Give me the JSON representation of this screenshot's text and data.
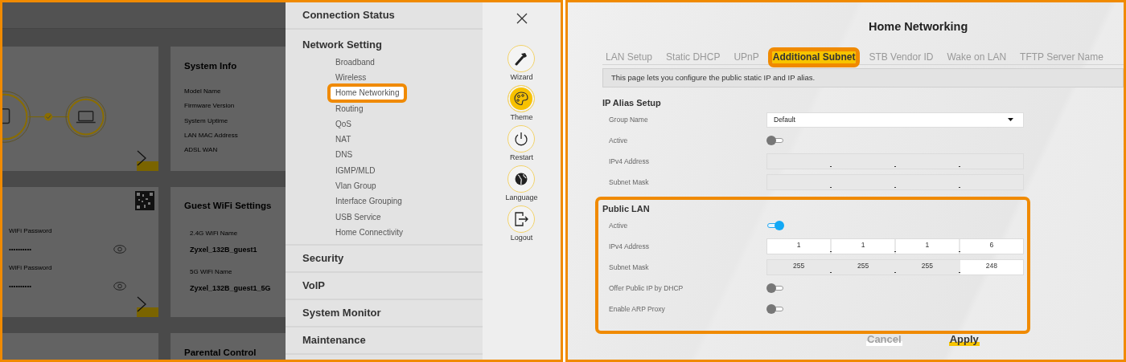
{
  "dashboard": {
    "system_info": {
      "title": "System Info",
      "labels": [
        "Model Name",
        "Firmware Version",
        "System Uptime",
        "LAN MAC Address",
        "ADSL WAN"
      ]
    },
    "wifi": {
      "fields": [
        {
          "label": "WiFi Password",
          "value": "••••••••••"
        },
        {
          "label": "WiFi Password",
          "value": "••••••••••"
        }
      ]
    },
    "guest_wifi": {
      "title": "Guest WiFi Settings",
      "fields": [
        {
          "label": "2.4G WiFi Name",
          "value": "Zyxel_132B_guest1"
        },
        {
          "label": "5G WiFi Name",
          "value": "Zyxel_132B_guest1_5G"
        }
      ]
    },
    "parental_control": {
      "title": "Parental Control"
    }
  },
  "menu": {
    "sections": [
      {
        "label": "Connection Status"
      },
      {
        "label": "Network Setting",
        "items": [
          {
            "label": "Broadband",
            "selected": false
          },
          {
            "label": "Wireless",
            "selected": false
          },
          {
            "label": "Home Networking",
            "selected": true
          },
          {
            "label": "Routing",
            "selected": false
          },
          {
            "label": "QoS",
            "selected": false
          },
          {
            "label": "NAT",
            "selected": false
          },
          {
            "label": "DNS",
            "selected": false
          },
          {
            "label": "IGMP/MLD",
            "selected": false
          },
          {
            "label": "Vlan Group",
            "selected": false
          },
          {
            "label": "Interface Grouping",
            "selected": false
          },
          {
            "label": "USB Service",
            "selected": false
          },
          {
            "label": "Home Connectivity",
            "selected": false
          }
        ]
      },
      {
        "label": "Security"
      },
      {
        "label": "VoIP"
      },
      {
        "label": "System Monitor"
      },
      {
        "label": "Maintenance"
      }
    ]
  },
  "rail": {
    "items": [
      {
        "kind": "wizard",
        "label": "Wizard",
        "selected": false
      },
      {
        "kind": "theme",
        "label": "Theme",
        "selected": true
      },
      {
        "kind": "restart",
        "label": "Restart",
        "selected": false
      },
      {
        "kind": "language",
        "label": "Language",
        "selected": false
      },
      {
        "kind": "logout",
        "label": "Logout",
        "selected": false
      }
    ]
  },
  "page": {
    "title": "Home Networking",
    "tabs": [
      {
        "label": "LAN Setup",
        "selected": false
      },
      {
        "label": "Static DHCP",
        "selected": false
      },
      {
        "label": "UPnP",
        "selected": false
      },
      {
        "label": "Additional Subnet",
        "selected": true
      },
      {
        "label": "STB Vendor ID",
        "selected": false
      },
      {
        "label": "Wake on LAN",
        "selected": false
      },
      {
        "label": "TFTP Server Name",
        "selected": false
      }
    ],
    "info": "This page lets you configure the public static IP and IP alias.",
    "sections": [
      {
        "title": "IP Alias Setup",
        "highlighted": false,
        "rows": [
          {
            "kind": "select",
            "label": "Group Name",
            "value": "Default"
          },
          {
            "kind": "toggle",
            "label": "Active",
            "on": false
          },
          {
            "kind": "ip",
            "label": "IPv4 Address",
            "octets": [
              {
                "disabled": true
              },
              {
                "disabled": true
              },
              {
                "disabled": true
              },
              {
                "disabled": true
              }
            ]
          },
          {
            "kind": "ip",
            "label": "Subnet Mask",
            "octets": [
              {
                "disabled": true
              },
              {
                "disabled": true
              },
              {
                "disabled": true
              },
              {
                "disabled": true
              }
            ]
          }
        ]
      },
      {
        "title": "Public LAN",
        "highlighted": true,
        "rows": [
          {
            "kind": "toggle",
            "label": "Active",
            "on": true
          },
          {
            "kind": "ip",
            "label": "IPv4 Address",
            "octets": [
              {
                "value": "1",
                "disabled": false
              },
              {
                "value": "1",
                "disabled": false
              },
              {
                "value": "1",
                "disabled": false
              },
              {
                "value": "6",
                "disabled": false
              }
            ]
          },
          {
            "kind": "ip",
            "label": "Subnet Mask",
            "octets": [
              {
                "value": "255",
                "disabled": true
              },
              {
                "value": "255",
                "disabled": true
              },
              {
                "value": "255",
                "disabled": true
              },
              {
                "value": "248",
                "disabled": false
              }
            ]
          },
          {
            "kind": "toggle",
            "label": "Offer Public IP by DHCP",
            "on": false
          },
          {
            "kind": "toggle",
            "label": "Enable ARP Proxy",
            "on": false
          }
        ]
      }
    ],
    "buttons": [
      {
        "kind": "cancel",
        "label": "Cancel"
      },
      {
        "kind": "apply",
        "label": "Apply"
      }
    ]
  }
}
